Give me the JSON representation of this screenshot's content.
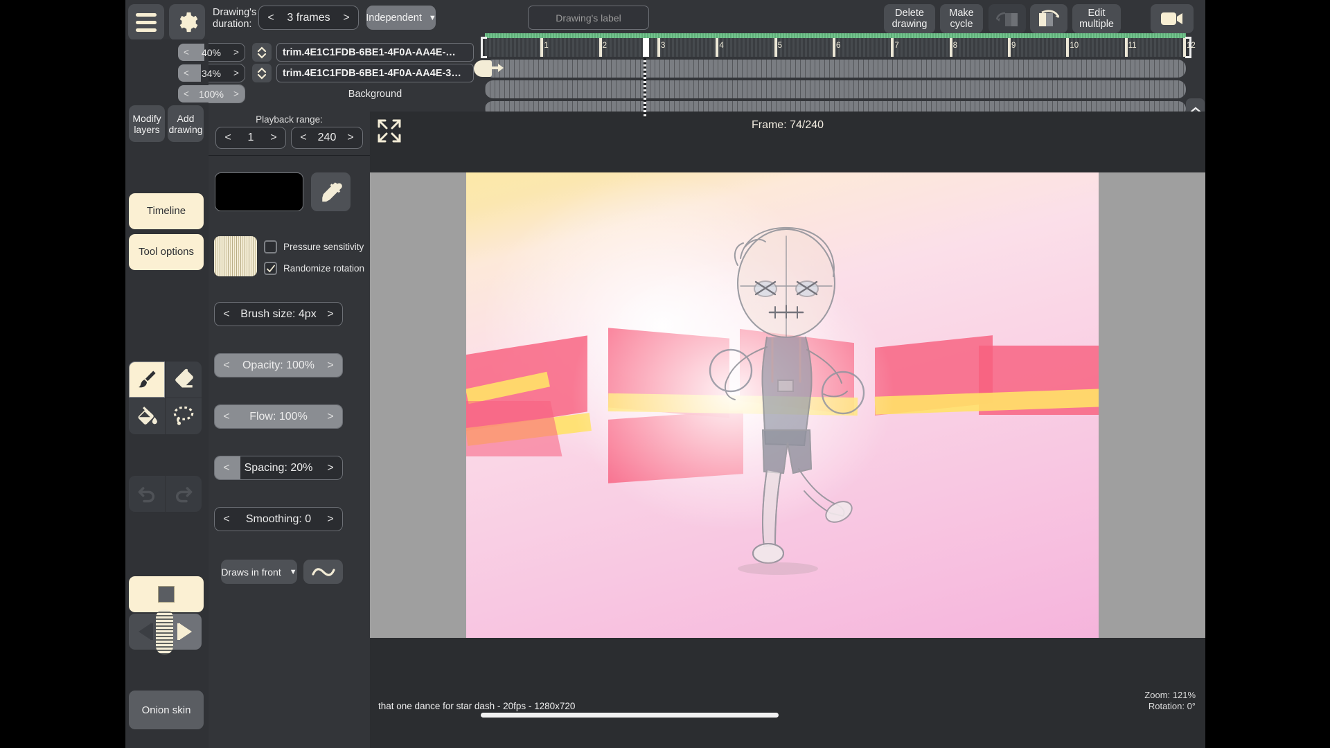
{
  "app": {
    "name": "flipaclip-style-animation-editor"
  },
  "topbar": {
    "menu_icon": "hamburger-icon",
    "settings_icon": "gear-icon",
    "duration_label": "Drawing's duration:",
    "duration_value": "3 frames",
    "prev_glyph": "<",
    "next_glyph": ">",
    "mode_value": "Independent",
    "mode_caret": "▼",
    "drawing_label_placeholder": "Drawing's label",
    "delete_drawing": "Delete\ndrawing",
    "delete_drawing_l1": "Delete",
    "delete_drawing_l2": "drawing",
    "make_cycle_l1": "Make",
    "make_cycle_l2": "cycle",
    "flip_back_icon": "flip-back-icon",
    "flip_forward_icon": "flip-forward-icon",
    "edit_multiple_l1": "Edit",
    "edit_multiple_l2": "multiple",
    "camera_icon": "video-camera-icon"
  },
  "layers": [
    {
      "opacity": "40%",
      "opacity_fill_pct": 40,
      "name": "trim.4E1C1FDB-6BE1-4F0A-AA4E-…",
      "has_field": true
    },
    {
      "opacity": "34%",
      "opacity_fill_pct": 34,
      "name": "trim.4E1C1FDB-6BE1-4F0A-AA4E-3…",
      "has_field": true
    },
    {
      "opacity": "100%",
      "opacity_fill_pct": 100,
      "name": "Background",
      "has_field": false
    }
  ],
  "timeline": {
    "ruler_ticks": [
      "1",
      "2",
      "3",
      "4",
      "5",
      "6",
      "7",
      "8",
      "9",
      "10",
      "11",
      "12"
    ],
    "playhead_frame": 74,
    "collapse_up_icon": "chevron-up-icon",
    "collapse_down_icon": "chevron-down-icon"
  },
  "rail": {
    "modify_layers_l1": "Modify",
    "modify_layers_l2": "layers",
    "add_drawing_l1": "Add",
    "add_drawing_l2": "drawing",
    "timeline_tab": "Timeline",
    "tool_options_tab": "Tool options",
    "tools": [
      {
        "name": "brush-tool",
        "icon": "paintbrush-icon",
        "selected": true
      },
      {
        "name": "eraser-tool",
        "icon": "eraser-icon",
        "selected": false
      },
      {
        "name": "fill-tool",
        "icon": "paint-bucket-icon",
        "selected": false
      },
      {
        "name": "lasso-tool",
        "icon": "lasso-icon",
        "selected": false
      }
    ],
    "undo_icon": "undo-icon",
    "redo_icon": "redo-icon",
    "stop_icon": "stop-square-icon",
    "prev_frame_icon": "play-previous-icon",
    "next_frame_icon": "play-next-icon",
    "onion_skin": "Onion skin"
  },
  "tool_options": {
    "playback_range_title": "Playback range:",
    "playback_start": "1",
    "playback_end": "240",
    "color_swatch_hex": "#000000",
    "eyedropper_icon": "eyedropper-icon",
    "brush_preview_icon": "brush-stamp-preview",
    "pressure_sensitivity_label": "Pressure sensitivity",
    "pressure_sensitivity_checked": false,
    "randomize_rotation_label": "Randomize rotation",
    "randomize_rotation_checked": true,
    "sliders": [
      {
        "id": "brush-size",
        "label": "Brush size:",
        "value": "4px",
        "fill_pct": 0,
        "bright": false
      },
      {
        "id": "opacity",
        "label": "Opacity:",
        "value": "100%",
        "fill_pct": 100,
        "bright": true
      },
      {
        "id": "flow",
        "label": "Flow:",
        "value": "100%",
        "fill_pct": 100,
        "bright": true
      },
      {
        "id": "spacing",
        "label": "Spacing:",
        "value": "20%",
        "fill_pct": 20,
        "bright": false
      },
      {
        "id": "smoothing",
        "label": "Smoothing:",
        "value": "0",
        "fill_pct": 0,
        "bright": false
      }
    ],
    "draws_in_front": "Draws in front",
    "draws_caret": "▼",
    "stabilizer_icon": "wave-line-icon"
  },
  "canvas": {
    "fullscreen_icon": "fullscreen-expand-icon",
    "frame_info": "Frame: 74/240",
    "document_title": "that one dance for star dash - 20fps - 1280x720",
    "zoom": "Zoom: 121%",
    "rotation": "Rotation: 0°"
  },
  "colors": {
    "app_bg": "#333539",
    "panel_bg": "#303236",
    "button_bg": "#4a4d52",
    "accent_cream": "#fbf0d3",
    "timeline_green": "#74c48e",
    "track_grey": "#7a7d82"
  }
}
